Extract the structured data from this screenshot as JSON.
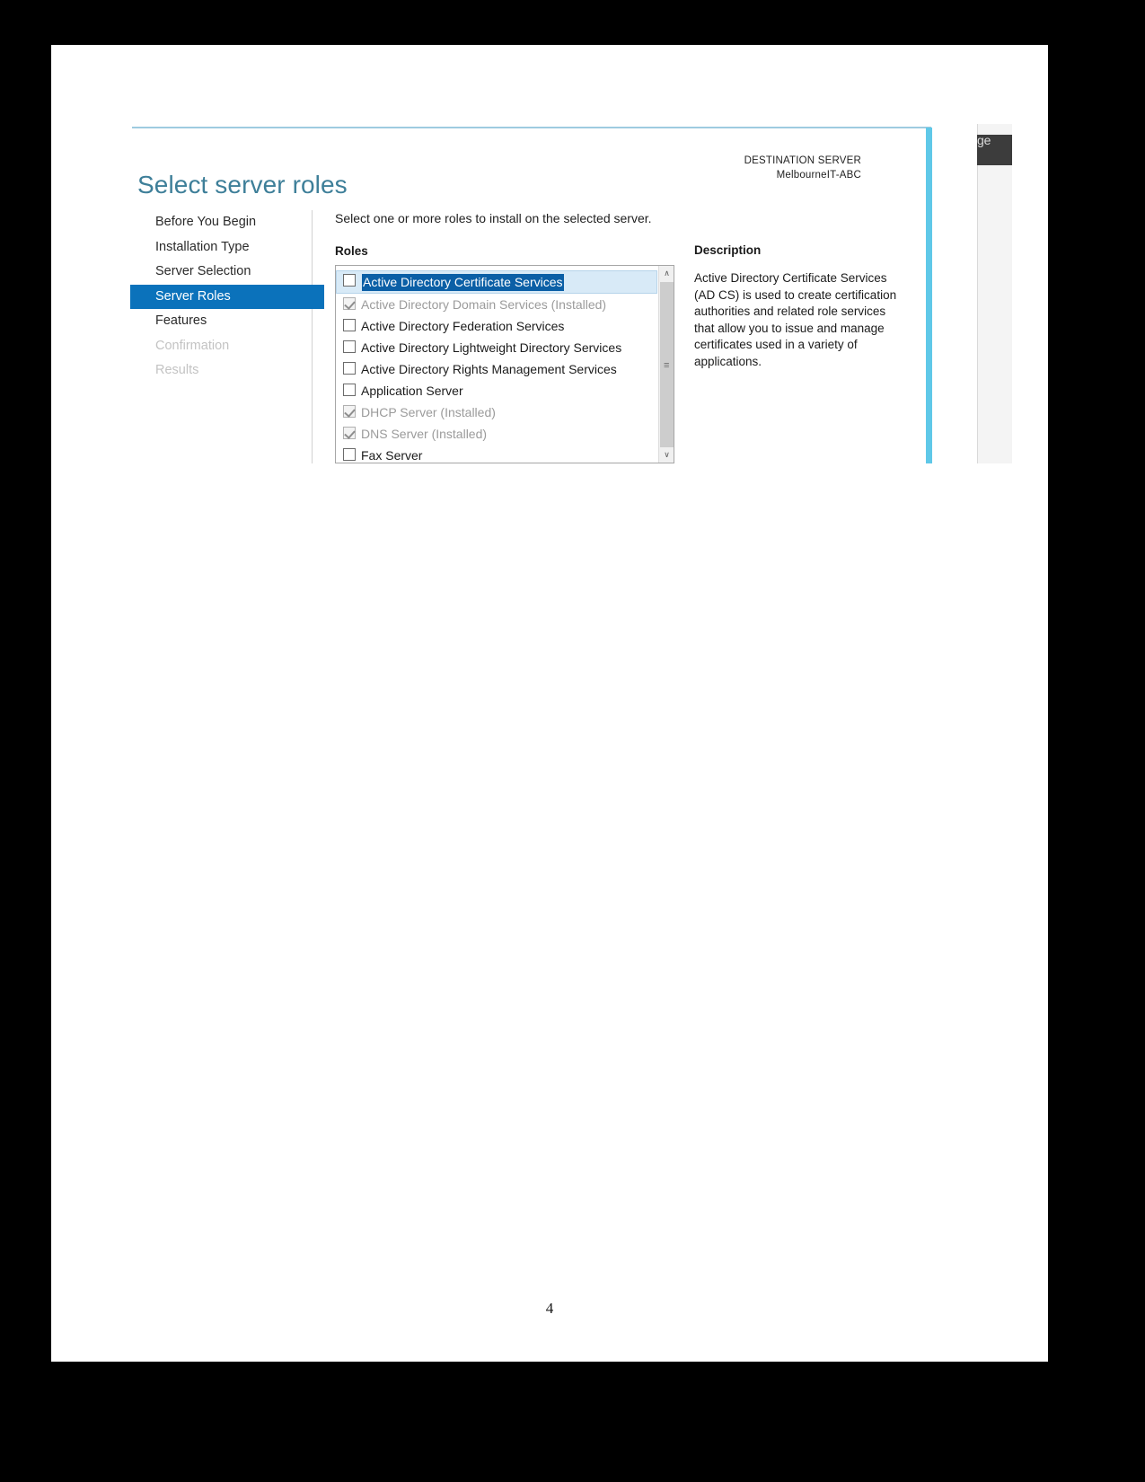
{
  "document": {
    "page_number": "4"
  },
  "background_window": {
    "menu_text_fragment": "ge"
  },
  "wizard": {
    "page_title": "Select server roles",
    "destination": {
      "label": "DESTINATION SERVER",
      "server_name": "MelbourneIT-ABC"
    },
    "instruction": "Select one or more roles to install on the selected server.",
    "nav": {
      "items": [
        {
          "label": "Before You Begin",
          "state": "normal"
        },
        {
          "label": "Installation Type",
          "state": "normal"
        },
        {
          "label": "Server Selection",
          "state": "normal"
        },
        {
          "label": "Server Roles",
          "state": "selected"
        },
        {
          "label": "Features",
          "state": "normal"
        },
        {
          "label": "Confirmation",
          "state": "disabled"
        },
        {
          "label": "Results",
          "state": "disabled"
        }
      ]
    },
    "roles_panel": {
      "header": "Roles",
      "items": [
        {
          "label": "Active Directory Certificate Services",
          "checked": false,
          "installed": false,
          "selected": true
        },
        {
          "label": "Active Directory Domain Services (Installed)",
          "checked": true,
          "installed": true,
          "selected": false
        },
        {
          "label": "Active Directory Federation Services",
          "checked": false,
          "installed": false,
          "selected": false
        },
        {
          "label": "Active Directory Lightweight Directory Services",
          "checked": false,
          "installed": false,
          "selected": false
        },
        {
          "label": "Active Directory Rights Management Services",
          "checked": false,
          "installed": false,
          "selected": false
        },
        {
          "label": "Application Server",
          "checked": false,
          "installed": false,
          "selected": false
        },
        {
          "label": "DHCP Server (Installed)",
          "checked": true,
          "installed": true,
          "selected": false
        },
        {
          "label": "DNS Server (Installed)",
          "checked": true,
          "installed": true,
          "selected": false
        },
        {
          "label": "Fax Server",
          "checked": false,
          "installed": false,
          "selected": false
        }
      ],
      "scroll_up_glyph": "∧",
      "scroll_down_glyph": "∨",
      "scroll_grip_glyph": "≡"
    },
    "description_panel": {
      "header": "Description",
      "text": "Active Directory Certificate Services (AD CS) is used to create certification authorities and related role services that allow you to issue and manage certificates used in a variety of applications."
    },
    "colors": {
      "title": "#3e7f99",
      "nav_selected_bg": "#0b72bb",
      "accent_edge": "#5fc8e8",
      "selection_highlight": "#0b5fa6",
      "selected_row_bg": "#d8eaf7"
    }
  }
}
